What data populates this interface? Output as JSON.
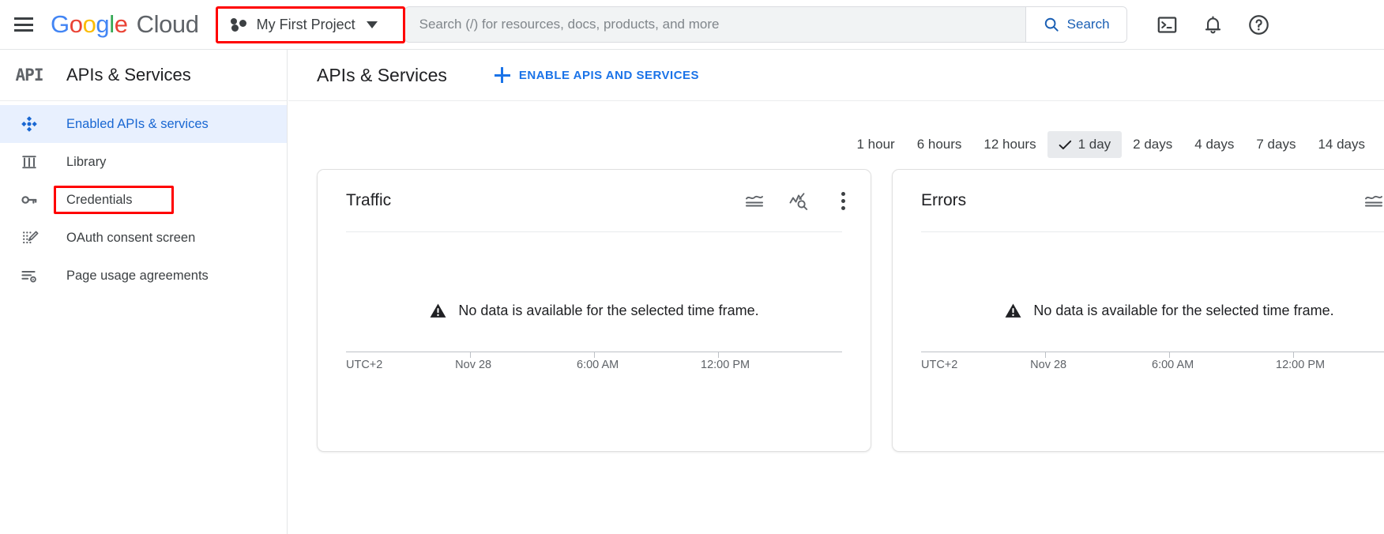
{
  "topbar": {
    "menu_icon": "hamburger-menu-icon",
    "logo": {
      "word_google": "Google",
      "letters": [
        "G",
        "o",
        "o",
        "g",
        "l",
        "e"
      ],
      "word_cloud": "Cloud"
    },
    "project_selector": {
      "name": "My First Project",
      "icon": "project-dots-icon",
      "caret": "chevron-down-icon",
      "highlighted": true,
      "highlight_color": "#ff0000"
    },
    "search": {
      "value": "",
      "placeholder": "Search (/) for resources, docs, products, and more",
      "button_label": "Search",
      "button_icon": "search-icon"
    },
    "icons": [
      {
        "name": "cloud-shell-icon",
        "label": "Activate Cloud Shell"
      },
      {
        "name": "notifications-bell-icon",
        "label": "Notifications"
      },
      {
        "name": "help-question-icon",
        "label": "Help"
      }
    ]
  },
  "sidebar": {
    "badge": "API",
    "title": "APIs & Services",
    "items": [
      {
        "label": "Enabled APIs & services",
        "icon": "enabled-apis-icon",
        "active": true,
        "highlighted": false
      },
      {
        "label": "Library",
        "icon": "library-icon",
        "active": false,
        "highlighted": false
      },
      {
        "label": "Credentials",
        "icon": "key-icon",
        "active": false,
        "highlighted": true
      },
      {
        "label": "OAuth consent screen",
        "icon": "oauth-consent-icon",
        "active": false,
        "highlighted": false
      },
      {
        "label": "Page usage agreements",
        "icon": "page-usage-icon",
        "active": false,
        "highlighted": false
      }
    ]
  },
  "main": {
    "title": "APIs & Services",
    "enable_button": {
      "label": "ENABLE APIS AND SERVICES",
      "icon": "plus-icon"
    },
    "time_ranges": [
      {
        "label": "1 hour",
        "selected": false
      },
      {
        "label": "6 hours",
        "selected": false
      },
      {
        "label": "12 hours",
        "selected": false
      },
      {
        "label": "1 day",
        "selected": true
      },
      {
        "label": "2 days",
        "selected": false
      },
      {
        "label": "4 days",
        "selected": false
      },
      {
        "label": "7 days",
        "selected": false
      },
      {
        "label": "14 days",
        "selected": false
      }
    ],
    "cards": [
      {
        "title": "Traffic",
        "empty_message": "No data is available for the selected time frame.",
        "empty_icon": "warning-triangle-icon",
        "actions": [
          {
            "name": "stacked-area-chart-icon"
          },
          {
            "name": "metrics-explorer-icon"
          },
          {
            "name": "more-options-kebab-icon"
          }
        ]
      },
      {
        "title": "Errors",
        "empty_message": "No data is available for the selected time frame.",
        "empty_icon": "warning-triangle-icon",
        "actions": [
          {
            "name": "stacked-area-chart-icon"
          },
          {
            "name": "metrics-explorer-icon"
          }
        ]
      }
    ]
  },
  "chart_data": [
    {
      "type": "area",
      "title": "Traffic",
      "xlabel": "",
      "ylabel": "",
      "timezone": "UTC+2",
      "x_tick_labels": [
        "UTC+2",
        "Nov 28",
        "6:00 AM",
        "12:00 PM"
      ],
      "series": [],
      "values": [],
      "empty": true,
      "empty_message": "No data is available for the selected time frame.",
      "grid": false,
      "legend": "none",
      "time_range": "1 day"
    },
    {
      "type": "area",
      "title": "Errors",
      "xlabel": "",
      "ylabel": "",
      "timezone": "UTC+2",
      "x_tick_labels": [
        "UTC+2",
        "Nov 28",
        "6:00 AM",
        "12:00 PM"
      ],
      "series": [],
      "values": [],
      "empty": true,
      "empty_message": "No data is available for the selected time frame.",
      "grid": false,
      "legend": "none",
      "time_range": "1 day"
    }
  ],
  "colors": {
    "accent_blue": "#1a73e8",
    "active_nav_bg": "#e8f0fe",
    "active_nav_text": "#1967d2",
    "annotation_red": "#ff0000",
    "selected_chip_bg": "#e8eaed"
  }
}
